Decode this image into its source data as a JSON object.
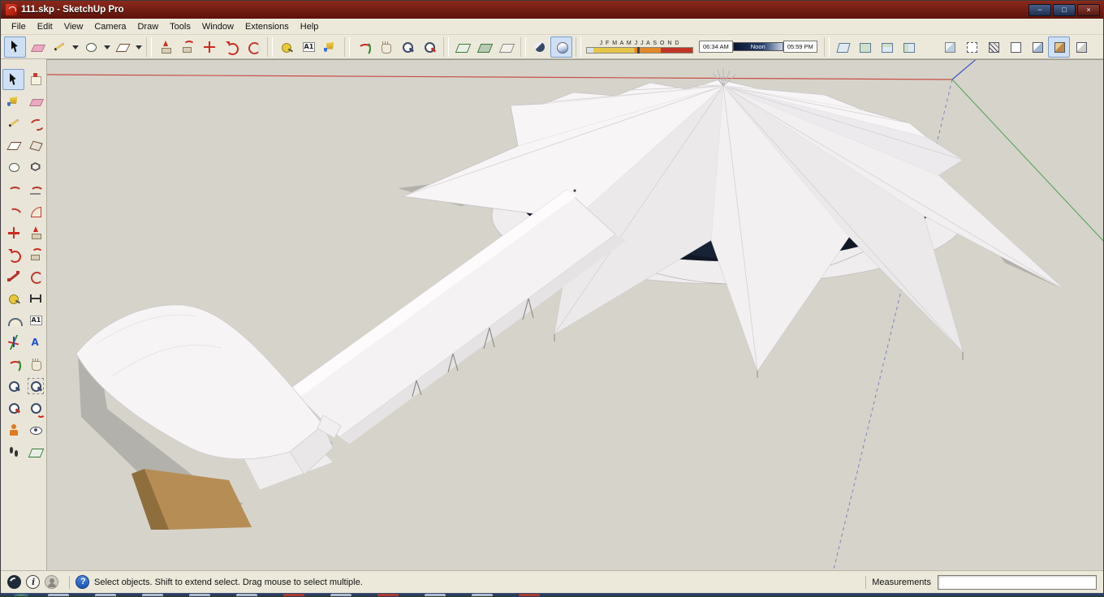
{
  "window": {
    "title": "111.skp - SketchUp Pro"
  },
  "titlebar": {
    "minimize": "−",
    "maximize": "□",
    "close": "×"
  },
  "menu": {
    "items": [
      "File",
      "Edit",
      "View",
      "Camera",
      "Draw",
      "Tools",
      "Window",
      "Extensions",
      "Help"
    ]
  },
  "toolbar": {
    "groups": {
      "g0": [
        "select",
        "eraser",
        "line",
        "line-options-caret",
        "circle",
        "circle-options-caret",
        "rect",
        "rect-options-caret"
      ],
      "g1": [
        "push-pull",
        "follow-me",
        "move",
        "rotate",
        "offset"
      ],
      "g2": [
        "tape-measure",
        "text",
        "paint"
      ],
      "g3": [
        "orbit",
        "pan",
        "zoom",
        "zoom-extents"
      ],
      "g4": [
        "section-plane",
        "section-fill",
        "section-display"
      ],
      "g5": [
        "xray",
        "shaded"
      ],
      "g8": [
        "view-iso",
        "view-top",
        "view-front",
        "view-right"
      ],
      "g9": [
        "style-xray",
        "style-back-edges",
        "style-wireframe",
        "style-hidden-line",
        "style-shaded",
        "style-shaded-textures",
        "style-monochrome"
      ]
    },
    "active": [
      "select",
      "shaded",
      "style-shaded-textures"
    ],
    "shadow": {
      "months_text": "J F M A M J J A S O N D",
      "time_start": "06:34 AM",
      "time_mid": "Noon",
      "time_end": "05:59 PM"
    }
  },
  "palette": {
    "tools": [
      "select",
      "make-component",
      "paint",
      "eraser",
      "line",
      "freehand",
      "rect",
      "rotated-rect",
      "circle",
      "polygon",
      "arc",
      "two-point-arc",
      "three-point-arc",
      "pie",
      "move",
      "push-pull",
      "rotate",
      "follow-me",
      "scale",
      "offset",
      "tape-measure",
      "dimension",
      "protractor",
      "text",
      "axes",
      "3d-text",
      "orbit",
      "pan",
      "zoom",
      "zoom-window",
      "zoom-extents",
      "previous",
      "position-camera",
      "look-around",
      "walk",
      "section-plane"
    ],
    "active": "select"
  },
  "statusbar": {
    "hint": "Select objects. Shift to extend select. Drag mouse to select multiple.",
    "measurements_label": "Measurements",
    "measurements_value": ""
  },
  "colors": {
    "titlebar": "#6e1810",
    "canvas_bg": "#d6d3cb",
    "glass_band": "#101826",
    "ground_tan": "#b68e55",
    "axis_red": "#c94f42",
    "axis_green": "#58a558",
    "axis_blue": "#3a56c9"
  }
}
